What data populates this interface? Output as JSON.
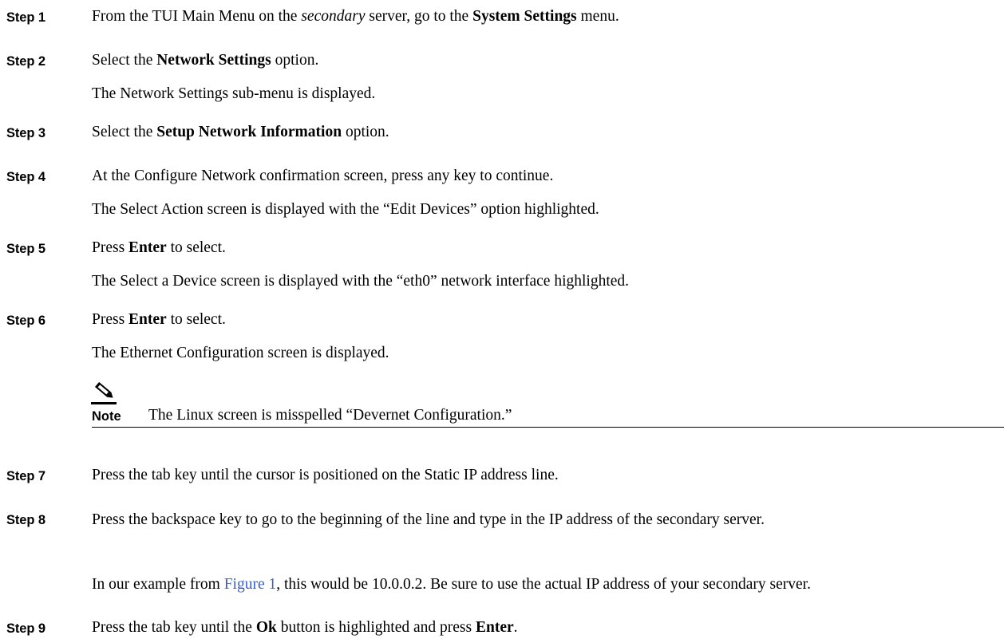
{
  "steps": [
    {
      "label": "Step 1",
      "parts": [
        "From the TUI Main Menu on the ",
        "secondary",
        " server, go to the ",
        "System Settings",
        " menu."
      ]
    },
    {
      "label": "Step 2",
      "parts": [
        "Select the ",
        "Network Settings",
        " option."
      ],
      "result": "The Network Settings sub-menu is displayed."
    },
    {
      "label": "Step 3",
      "parts": [
        "Select the ",
        "Setup Network Information",
        " option."
      ]
    },
    {
      "label": "Step 4",
      "text": "At the Configure Network confirmation screen, press any key to continue.",
      "result": "The Select Action screen is displayed with the “Edit Devices” option highlighted."
    },
    {
      "label": "Step 5",
      "parts": [
        "Press ",
        "Enter",
        " to select."
      ],
      "result": "The Select a Device screen is displayed with the “eth0” network interface highlighted."
    },
    {
      "label": "Step 6",
      "parts": [
        "Press ",
        "Enter",
        " to select."
      ],
      "result": "The Ethernet Configuration screen is displayed."
    },
    {
      "label": "Step 7",
      "text": "Press the tab key until the cursor is positioned on the Static IP address line."
    },
    {
      "label": "Step 8",
      "text": "Press the backspace key to go to the beginning of the line and type in the IP address of the secondary server.",
      "result_parts": [
        "In our example from ",
        "Figure 1",
        ", this would be 10.0.0.2. Be sure to use the actual IP address of your secondary server."
      ]
    },
    {
      "label": "Step 9",
      "parts": [
        "Press the tab key until the ",
        "Ok",
        " button is highlighted and press ",
        "Enter",
        "."
      ]
    }
  ],
  "note": {
    "label": "Note",
    "text": "The Linux screen is misspelled “Devernet Configuration.”",
    "icon": "pencil-note-icon"
  },
  "colors": {
    "link": "#3b5fc2",
    "text": "#000000"
  }
}
